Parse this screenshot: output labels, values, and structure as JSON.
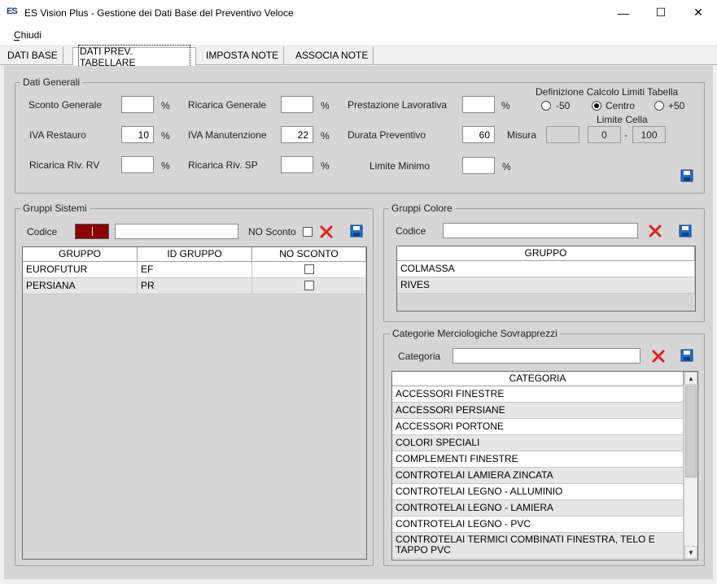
{
  "window": {
    "icon_text": "ES",
    "title": "ES Vision Plus - Gestione dei Dati Base del Preventivo Veloce",
    "minimize": "—",
    "maximize": "☐",
    "close": "✕"
  },
  "menu": {
    "chiudi": "Chiudi"
  },
  "tabs": [
    "DATI BASE",
    "DATI PREV. TABELLARE",
    "IMPOSTA NOTE",
    "ASSOCIA NOTE"
  ],
  "dati_generali": {
    "title": "Dati Generali",
    "sconto_generale": {
      "label": "Sconto Generale",
      "value": "",
      "unit": "%"
    },
    "ricarica_generale": {
      "label": "Ricarica Generale",
      "value": "",
      "unit": "%"
    },
    "prestazione_lavorativa": {
      "label": "Prestazione Lavorativa",
      "value": "",
      "unit": "%"
    },
    "iva_restauro": {
      "label": "IVA Restauro",
      "value": "10",
      "unit": "%"
    },
    "iva_manutenzione": {
      "label": "IVA Manutenzione",
      "value": "22",
      "unit": "%"
    },
    "durata_preventivo": {
      "label": "Durata Preventivo",
      "value": "60"
    },
    "ricarica_riv_rv": {
      "label": "Ricarica Riv. RV",
      "value": "",
      "unit": "%"
    },
    "ricarica_riv_sp": {
      "label": "Ricarica Riv. SP",
      "value": "",
      "unit": "%"
    },
    "limite_minimo": {
      "label": "Limite Minimo",
      "value": "",
      "unit": "%"
    },
    "definizione_title": "Definizione Calcolo Limiti Tabella",
    "radios": [
      {
        "label": "-50",
        "selected": false
      },
      {
        "label": "Centro",
        "selected": true
      },
      {
        "label": "+50",
        "selected": false
      }
    ],
    "limite_cella_label": "Limite Cella",
    "misura_label": "Misura",
    "misura_value": "",
    "limite_min": "0",
    "limite_sep": "-",
    "limite_max": "100"
  },
  "gruppi_sistemi": {
    "title": "Gruppi Sistemi",
    "codice_label": "Codice",
    "codice_value": "",
    "no_sconto_label": "NO Sconto",
    "columns": [
      "GRUPPO",
      "ID GRUPPO",
      "NO SCONTO"
    ],
    "rows": [
      {
        "gruppo": "EUROFUTUR",
        "id": "EF",
        "no_sconto": false
      },
      {
        "gruppo": "PERSIANA",
        "id": "PR",
        "no_sconto": false
      }
    ],
    "color_swatch": "#8b0000"
  },
  "gruppi_colore": {
    "title": "Gruppi Colore",
    "codice_label": "Codice",
    "codice_value": "",
    "columns": [
      "GRUPPO"
    ],
    "rows": [
      "COLMASSA",
      "RIVES"
    ]
  },
  "categorie": {
    "title": "Categorie Merciologiche Sovrapprezzi",
    "categoria_label": "Categoria",
    "categoria_value": "",
    "columns": [
      "CATEGORIA"
    ],
    "rows": [
      "ACCESSORI FINESTRE",
      "ACCESSORI PERSIANE",
      "ACCESSORI PORTONE",
      "COLORI SPECIALI",
      "COMPLEMENTI FINESTRE",
      "CONTROTELAI LAMIERA ZINCATA",
      "CONTROTELAI LEGNO - ALLUMINIO",
      "CONTROTELAI LEGNO - LAMIERA",
      "CONTROTELAI LEGNO - PVC",
      "CONTROTELAI TERMICI COMBINATI FINESTRA, TELO E TAPPO PVC"
    ]
  },
  "colors": {
    "delete_red": "#e02020",
    "save_blue": "#1e6fd0",
    "panel_bg": "#d6d6d6"
  }
}
